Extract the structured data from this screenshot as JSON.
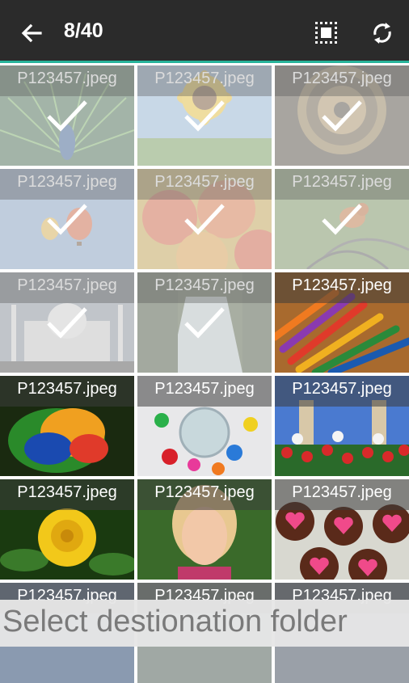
{
  "appbar": {
    "title": "8/40",
    "back_icon": "arrow-left-icon",
    "select_all_icon": "select-all-icon",
    "rotate_icon": "rotate-icon",
    "background": "#2b2b2b",
    "accent": "#27b39a"
  },
  "grid": {
    "items": [
      {
        "filename": "P123457.jpeg",
        "selected": true,
        "subject": "peacock"
      },
      {
        "filename": "P123457.jpeg",
        "selected": true,
        "subject": "sunflower"
      },
      {
        "filename": "P123457.jpeg",
        "selected": true,
        "subject": "pocket-watch"
      },
      {
        "filename": "P123457.jpeg",
        "selected": true,
        "subject": "hot-air-balloons"
      },
      {
        "filename": "P123457.jpeg",
        "selected": true,
        "subject": "apples"
      },
      {
        "filename": "P123457.jpeg",
        "selected": true,
        "subject": "bird"
      },
      {
        "filename": "P123457.jpeg",
        "selected": true,
        "subject": "taj-mahal"
      },
      {
        "filename": "P123457.jpeg",
        "selected": true,
        "subject": "waterfall"
      },
      {
        "filename": "P123457.jpeg",
        "selected": false,
        "subject": "colored-pencils"
      },
      {
        "filename": "P123457.jpeg",
        "selected": false,
        "subject": "parrot"
      },
      {
        "filename": "P123457.jpeg",
        "selected": false,
        "subject": "candy-jar"
      },
      {
        "filename": "P123457.jpeg",
        "selected": false,
        "subject": "tulips"
      },
      {
        "filename": "P123457.jpeg",
        "selected": false,
        "subject": "yellow-rose"
      },
      {
        "filename": "P123457.jpeg",
        "selected": false,
        "subject": "woman-portrait"
      },
      {
        "filename": "P123457.jpeg",
        "selected": false,
        "subject": "heart-cupcakes"
      },
      {
        "filename": "P123457.jpeg",
        "selected": false,
        "subject": "partial"
      },
      {
        "filename": "P123457.jpeg",
        "selected": false,
        "subject": "partial"
      },
      {
        "filename": "P123457.jpeg",
        "selected": false,
        "subject": "partial"
      }
    ]
  },
  "footer": {
    "text": "Select destionation folder"
  }
}
